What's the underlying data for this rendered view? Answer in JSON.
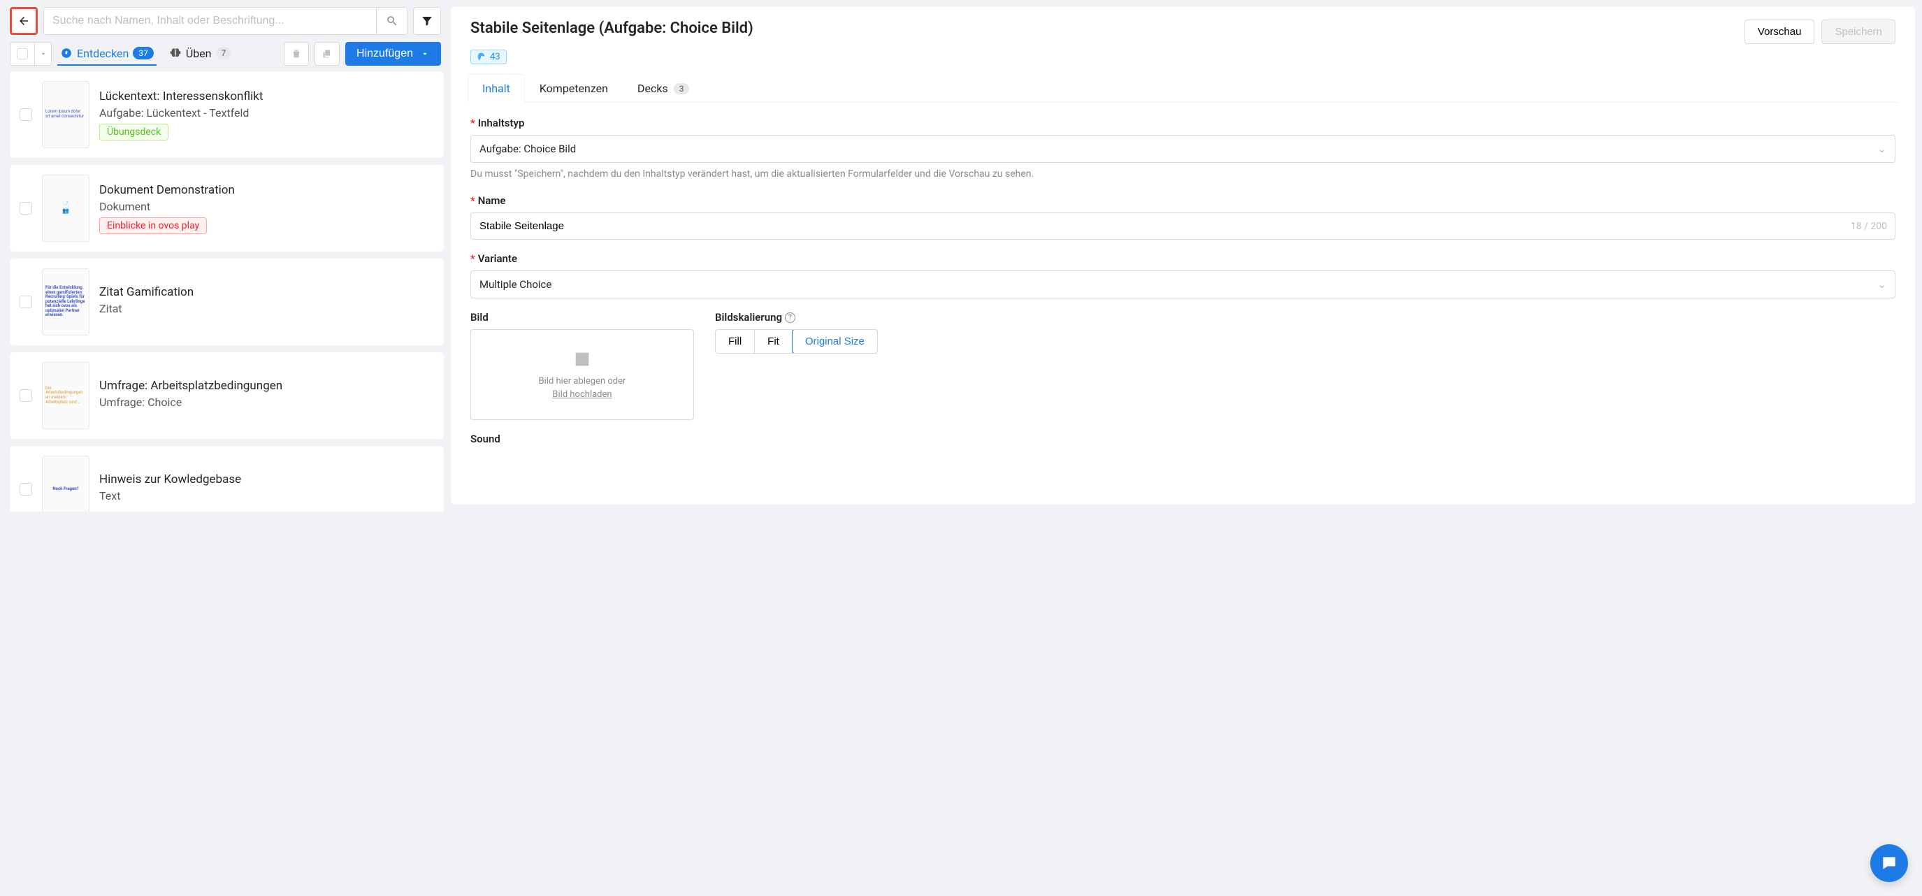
{
  "search": {
    "placeholder": "Suche nach Namen, Inhalt oder Beschriftung..."
  },
  "toolbar": {
    "tabs": [
      {
        "label": "Entdecken",
        "count": "37"
      },
      {
        "label": "Üben",
        "count": "7"
      }
    ],
    "add_label": "Hinzufügen"
  },
  "list": [
    {
      "title": "Lückentext: Interessenskonflikt",
      "sub": "Aufgabe: Lückentext - Textfeld",
      "tag": "Übungsdeck",
      "tag_variant": "green"
    },
    {
      "title": "Dokument Demonstration",
      "sub": "Dokument",
      "tag": "Einblicke in ovos play",
      "tag_variant": "red"
    },
    {
      "title": "Zitat Gamification",
      "sub": "Zitat",
      "tag": null
    },
    {
      "title": "Umfrage: Arbeitsplatzbedingungen",
      "sub": "Umfrage: Choice",
      "tag": null
    },
    {
      "title": "Hinweis zur Kowledgebase",
      "sub": "Text",
      "tag": null
    }
  ],
  "detail": {
    "title": "Stabile Seitenlage (Aufgabe: Choice Bild)",
    "preview_label": "Vorschau",
    "save_label": "Speichern",
    "fingerprint_count": "43",
    "tabs": [
      {
        "label": "Inhalt"
      },
      {
        "label": "Kompetenzen"
      },
      {
        "label": "Decks",
        "count": "3"
      }
    ],
    "form": {
      "content_type_label": "Inhaltstyp",
      "content_type_value": "Aufgabe: Choice Bild",
      "content_type_hint": "Du musst \"Speichern\", nachdem du den Inhaltstyp verändert hast, um die aktualisierten Formularfelder und die Vorschau zu sehen.",
      "name_label": "Name",
      "name_value": "Stabile Seitenlage",
      "name_count": "18 / 200",
      "variant_label": "Variante",
      "variant_value": "Multiple Choice",
      "image_label": "Bild",
      "image_drop": "Bild hier ablegen oder",
      "image_upload": "Bild hochladen",
      "scale_label": "Bildskalierung",
      "scale_options": [
        "Fill",
        "Fit",
        "Original Size"
      ],
      "scale_active": "Original Size",
      "sound_label": "Sound"
    }
  }
}
